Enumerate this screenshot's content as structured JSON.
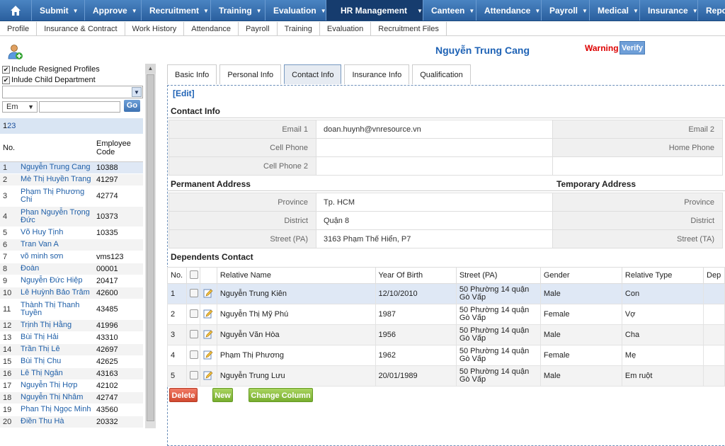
{
  "topnav": {
    "items": [
      {
        "label": "Submit"
      },
      {
        "label": "Approve"
      },
      {
        "label": "Recruitment"
      },
      {
        "label": "Training"
      },
      {
        "label": "Evaluation"
      },
      {
        "label": "HR Management"
      },
      {
        "label": "Canteen"
      },
      {
        "label": "Attendance"
      },
      {
        "label": "Payroll"
      },
      {
        "label": "Medical"
      },
      {
        "label": "Insurance"
      },
      {
        "label": "Report"
      }
    ]
  },
  "subnav": {
    "items": [
      {
        "label": "Profile"
      },
      {
        "label": "Insurance & Contract"
      },
      {
        "label": "Work History"
      },
      {
        "label": "Attendance"
      },
      {
        "label": "Payroll"
      },
      {
        "label": "Training"
      },
      {
        "label": "Evaluation"
      },
      {
        "label": "Recruitment Files"
      }
    ]
  },
  "sidebar": {
    "include_resigned": "Include Resigned Profiles",
    "include_child": "Inlude Child Department",
    "filter_select": "Em",
    "go": "Go",
    "pages": [
      "1",
      "2",
      "3"
    ],
    "col_no": "No.",
    "col_code": "Employee Code",
    "employees": [
      {
        "no": "1",
        "name": "Nguyễn Trung Cang",
        "code": "10388"
      },
      {
        "no": "2",
        "name": "Mè Thị Huyền Trang",
        "code": "41297"
      },
      {
        "no": "3",
        "name": "Phạm Thị Phương Chi",
        "code": "42774"
      },
      {
        "no": "4",
        "name": "Phan Nguyễn Trọng Đức",
        "code": "10373"
      },
      {
        "no": "5",
        "name": "Võ Huy Tịnh",
        "code": "10335"
      },
      {
        "no": "6",
        "name": "Tran Van A",
        "code": ""
      },
      {
        "no": "7",
        "name": "võ minh sơn",
        "code": "vms123"
      },
      {
        "no": "8",
        "name": "Đoàn",
        "code": "00001"
      },
      {
        "no": "9",
        "name": "Nguyễn Đức Hiệp",
        "code": "20417"
      },
      {
        "no": "10",
        "name": "Lê Huỳnh Bảo Trâm",
        "code": "42600"
      },
      {
        "no": "11",
        "name": "Thành Thị Thanh Tuyền",
        "code": "43485"
      },
      {
        "no": "12",
        "name": "Trịnh Thị Hằng",
        "code": "41996"
      },
      {
        "no": "13",
        "name": "Bùi Thị Hải",
        "code": "43310"
      },
      {
        "no": "14",
        "name": "Trần Thị Lê",
        "code": "42697"
      },
      {
        "no": "15",
        "name": "Bùi Thị Chu",
        "code": "42625"
      },
      {
        "no": "16",
        "name": "Lê Thị Ngân",
        "code": "43163"
      },
      {
        "no": "17",
        "name": "Nguyễn Thị Hợp",
        "code": "42102"
      },
      {
        "no": "18",
        "name": "Nguyễn Thị Nhâm",
        "code": "42747"
      },
      {
        "no": "19",
        "name": "Phan Thị Ngọc Minh",
        "code": "43560"
      },
      {
        "no": "20",
        "name": "Điền Thu Hà",
        "code": "20332"
      }
    ]
  },
  "main": {
    "employee_name": "Nguyễn Trung Cang",
    "warning": "Warning",
    "verify": "Verify",
    "tabs": [
      {
        "label": "Basic Info"
      },
      {
        "label": "Personal Info"
      },
      {
        "label": "Contact Info"
      },
      {
        "label": "Insurance Info"
      },
      {
        "label": "Qualification"
      }
    ],
    "edit": "[Edit]",
    "contact_title": "Contact Info",
    "contact": {
      "email1_label": "Email 1",
      "email1": "doan.huynh@vnresource.vn",
      "email2_label": "Email 2",
      "cell_label": "Cell Phone",
      "home_label": "Home Phone",
      "cell2_label": "Cell Phone 2"
    },
    "perm_title": "Permanent Address",
    "temp_title": "Temporary Address",
    "perm": {
      "province_label": "Province",
      "province": "Tp. HCM",
      "district_label": "District",
      "district": "Quận 8",
      "street_label": "Street (PA)",
      "street": "3163 Phạm Thế Hiển, P7"
    },
    "temp": {
      "province_label": "Province",
      "district_label": "District",
      "street_label": "Street (TA)"
    },
    "dep_title": "Dependents Contact",
    "dep_cols": {
      "no": "No.",
      "name": "Relative Name",
      "yob": "Year Of Birth",
      "street": "Street (PA)",
      "gender": "Gender",
      "type": "Relative Type",
      "dep": "Dep"
    },
    "dependents": [
      {
        "no": "1",
        "name": "Nguyễn Trung Kiên",
        "yob": "12/10/2010",
        "street": "50 Phường 14 quận Gò Vấp",
        "gender": "Male",
        "type": "Con"
      },
      {
        "no": "2",
        "name": "Nguyễn Thị Mỹ Phú",
        "yob": "1987",
        "street": "50 Phường 14 quận Gò Vấp",
        "gender": "Female",
        "type": "Vợ"
      },
      {
        "no": "3",
        "name": "Nguyễn Văn Hòa",
        "yob": "1956",
        "street": "50 Phường 14 quận Gò Vấp",
        "gender": "Male",
        "type": "Cha"
      },
      {
        "no": "4",
        "name": "Phạm Thị Phương",
        "yob": "1962",
        "street": "50 Phường 14 quận Gò Vấp",
        "gender": "Female",
        "type": "Mẹ"
      },
      {
        "no": "5",
        "name": "Nguyễn Trung Lưu",
        "yob": "20/01/1989",
        "street": "50 Phường 14 quận Gò Vấp",
        "gender": "Male",
        "type": "Em ruột"
      }
    ],
    "buttons": {
      "delete": "Delete",
      "new": "New",
      "change_column": "Change Column"
    }
  },
  "colors": {
    "nav": "#2a5f9e",
    "nav_active": "#163c6e",
    "link": "#1e62b5",
    "warning": "#dd0000",
    "delete": "#d24a30",
    "green": "#78ae2f"
  },
  "icons": [
    "home-icon",
    "add-user-icon",
    "chevron-down-icon",
    "edit-pencil-icon"
  ]
}
